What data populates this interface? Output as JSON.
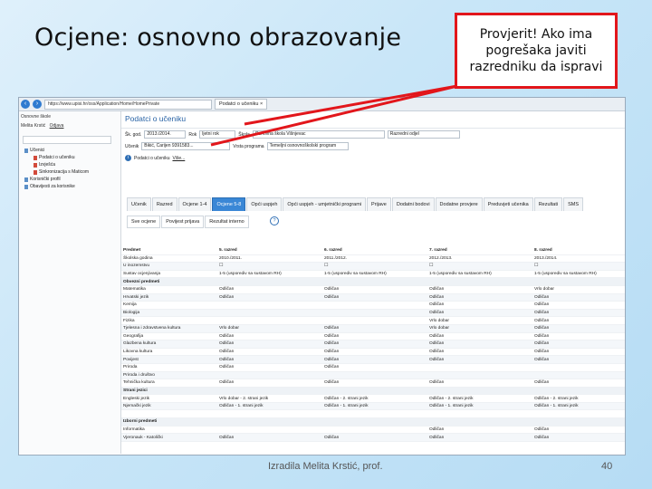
{
  "slide": {
    "title": "Ocjene: osnovno obrazovanje",
    "callout": "Provjerit! Ako ima pogrešaka javiti razredniku da ispravi",
    "footer": "Izradila Melita Krstić, prof.",
    "page_number": "40"
  },
  "colors": {
    "callout_border": "#e2161b",
    "accent": "#3a87d6",
    "arrow": "#e2161b"
  },
  "browser": {
    "url": "https://www.upisi.hr/oss/Application/Home/HomePrivate",
    "tab": "Podatci o učeniku ×"
  },
  "sidebar": {
    "header": "Osnovne škole",
    "user": "Melita Krstić",
    "user_link": "Odjava",
    "tree": [
      {
        "label": "Učenici",
        "level": 0
      },
      {
        "label": "Podatci o učeniku",
        "level": 1
      },
      {
        "label": "Izvješća",
        "level": 1
      },
      {
        "label": "Sinkronizacija s Maticom",
        "level": 1
      },
      {
        "label": "Korisnički profil",
        "level": 0
      },
      {
        "label": "Obavijesti za korisnike",
        "level": 0
      }
    ]
  },
  "main": {
    "header": "Podatci o učeniku",
    "filters": {
      "year_label": "Šk. god.",
      "year_value": "2013./2014.",
      "deadline_label": "Rok",
      "deadline_value": "ljetni rok",
      "school_label": "Škola",
      "school_value": "Osnovna škola Višnjevac",
      "class_value": "Razredni odjel",
      "student_label": "Učenik",
      "student_value": "Bikić, Carijen 9391583... ",
      "program_label": "Vrsta programa",
      "program_value": "Temeljni osnovnoškolski program"
    },
    "info": {
      "label": "Podatci o učeniku",
      "link": "Više..."
    },
    "tabs": [
      "Učenik",
      "Razred",
      "Ocjene 1-4",
      "Ocjene 5-8",
      "Opći uspjeh",
      "Opći uspjeh - umjetnički programi",
      "Prijave",
      "Dodatni bodovi",
      "Dodatne provjere",
      "Preduvjeti učenika",
      "Rezultati",
      "SMS"
    ],
    "active_tab": "Ocjene 5-8",
    "subtabs": [
      "Sve ocjene",
      "Povijest prijava",
      "Rezultat interno"
    ]
  },
  "grades": {
    "headers": [
      "Predmet",
      "5. razred",
      "6. razred",
      "7. razred",
      "8. razred"
    ],
    "rows": [
      {
        "type": "row",
        "cells": [
          "Školska godina",
          "2010./2011.",
          "2011./2012.",
          "2012./2013.",
          "2013./2014."
        ]
      },
      {
        "type": "row",
        "cells": [
          "U inozemstvu",
          "☐",
          "☐",
          "☐",
          "☐"
        ]
      },
      {
        "type": "row",
        "cells": [
          "Sustav ocjenjivanja",
          "1-5 (usporediv sa sustavom RH)",
          "1-5 (usporediv sa sustavom RH)",
          "1-5 (usporediv sa sustavom RH)",
          "1-5 (usporediv sa sustavom RH)"
        ]
      },
      {
        "type": "section",
        "cells": [
          "Obvezni predmeti",
          "",
          "",
          "",
          ""
        ]
      },
      {
        "type": "row",
        "cells": [
          "Matematika",
          "Odličan",
          "Odličan",
          "Odličan",
          "Vrlo dobar"
        ]
      },
      {
        "type": "row",
        "cells": [
          "Hrvatski jezik",
          "Odličan",
          "Odličan",
          "Odličan",
          "Odličan"
        ]
      },
      {
        "type": "row",
        "cells": [
          "Kemija",
          "",
          "",
          "Odličan",
          "Odličan"
        ]
      },
      {
        "type": "row",
        "cells": [
          "Biologija",
          "",
          "",
          "Odličan",
          "Odličan"
        ]
      },
      {
        "type": "row",
        "cells": [
          "Fizika",
          "",
          "",
          "Vrlo dobar",
          "Odličan"
        ]
      },
      {
        "type": "row",
        "cells": [
          "Tjelesna i zdravstvena kultura",
          "Vrlo dobar",
          "Odličan",
          "Vrlo dobar",
          "Odličan"
        ]
      },
      {
        "type": "row",
        "cells": [
          "Geografija",
          "Odličan",
          "Odličan",
          "Odličan",
          "Odličan"
        ]
      },
      {
        "type": "row",
        "cells": [
          "Glazbena kultura",
          "Odličan",
          "Odličan",
          "Odličan",
          "Odličan"
        ]
      },
      {
        "type": "row",
        "cells": [
          "Likovna kultura",
          "Odličan",
          "Odličan",
          "Odličan",
          "Odličan"
        ]
      },
      {
        "type": "row",
        "cells": [
          "Povijest",
          "Odličan",
          "Odličan",
          "Odličan",
          "Odličan"
        ]
      },
      {
        "type": "row",
        "cells": [
          "Priroda",
          "Odličan",
          "Odličan",
          "",
          ""
        ]
      },
      {
        "type": "row",
        "cells": [
          "Priroda i društvo",
          "",
          "",
          "",
          ""
        ]
      },
      {
        "type": "row",
        "cells": [
          "Tehnička kultura",
          "Odličan",
          "Odličan",
          "Odličan",
          "Odličan"
        ]
      },
      {
        "type": "section",
        "cells": [
          "Strani jezici",
          "",
          "",
          "",
          ""
        ]
      },
      {
        "type": "row",
        "cells": [
          "Engleski jezik",
          "Vrlo dobar - 2. strani jezik",
          "Odličan - 2. strani jezik",
          "Odličan - 2. strani jezik",
          "Odličan - 2. strani jezik"
        ]
      },
      {
        "type": "row",
        "cells": [
          "Njemački jezik",
          "Odličan - 1. strani jezik",
          "Odličan - 1. strani jezik",
          "Odličan - 1. strani jezik",
          "Odličan - 1. strani jezik"
        ]
      },
      {
        "type": "row",
        "cells": [
          "",
          "",
          "",
          "",
          ""
        ]
      },
      {
        "type": "section",
        "cells": [
          "Izborni predmeti",
          "",
          "",
          "",
          ""
        ]
      },
      {
        "type": "row",
        "cells": [
          "Informatika",
          "",
          "",
          "Odličan",
          "Odličan"
        ]
      },
      {
        "type": "row",
        "cells": [
          "Vjeronauk - Katolički",
          "Odličan",
          "Odličan",
          "Odličan",
          "Odličan"
        ]
      }
    ]
  }
}
